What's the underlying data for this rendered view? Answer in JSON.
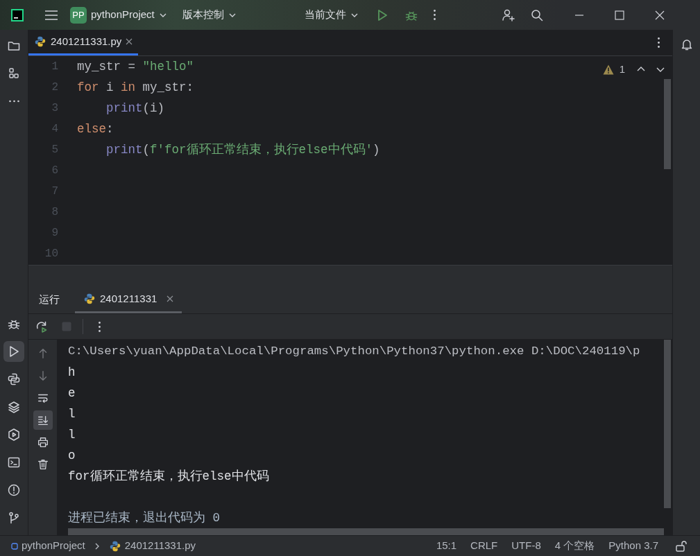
{
  "title_bar": {
    "project_badge": "PP",
    "project": "pythonProject",
    "vcs": "版本控制",
    "run_config": "当前文件"
  },
  "tool_windows_top": [
    {
      "kind": "folder",
      "selected": false
    },
    {
      "kind": "structure",
      "selected": false
    },
    {
      "kind": "more",
      "selected": false
    }
  ],
  "tool_windows_bottom": [
    {
      "kind": "bug",
      "selected": false
    },
    {
      "kind": "run",
      "selected": true
    },
    {
      "kind": "python",
      "selected": false
    },
    {
      "kind": "layers",
      "selected": false
    },
    {
      "kind": "services",
      "selected": false
    },
    {
      "kind": "terminal",
      "selected": false
    },
    {
      "kind": "problems",
      "selected": false
    },
    {
      "kind": "git",
      "selected": false
    }
  ],
  "editor_tabs": [
    {
      "label": "2401211331.py",
      "selected": true
    }
  ],
  "inspection": {
    "warnings": "1"
  },
  "code_lines": [
    {
      "number": "1",
      "tokens": [
        {
          "kind": "plain",
          "text": "my_str = "
        },
        {
          "kind": "string",
          "text": "\"hello\""
        }
      ]
    },
    {
      "number": "2",
      "tokens": [
        {
          "kind": "keyword",
          "text": "for"
        },
        {
          "kind": "plain",
          "text": " i "
        },
        {
          "kind": "keyword",
          "text": "in"
        },
        {
          "kind": "plain",
          "text": " my_str:"
        }
      ]
    },
    {
      "number": "3",
      "tokens": [
        {
          "kind": "builtin",
          "text": "    print"
        },
        {
          "kind": "plain",
          "text": "(i)"
        }
      ]
    },
    {
      "number": "4",
      "tokens": [
        {
          "kind": "keyword",
          "text": "else"
        },
        {
          "kind": "plain",
          "text": ":"
        }
      ]
    },
    {
      "number": "5",
      "tokens": [
        {
          "kind": "builtin",
          "text": "    print"
        },
        {
          "kind": "plain",
          "text": "("
        },
        {
          "kind": "string",
          "text": "f'for循环正常结束，执行else中代码'"
        },
        {
          "kind": "plain",
          "text": ")"
        }
      ]
    },
    {
      "number": "6"
    },
    {
      "number": "7"
    },
    {
      "number": "8"
    },
    {
      "number": "9"
    },
    {
      "number": "10"
    }
  ],
  "run_panel": {
    "title": "运行",
    "tabs": [
      {
        "label": "2401211331",
        "selected": true
      }
    ],
    "toolbar": [
      {
        "kind": "rerun",
        "disabled": false
      },
      {
        "kind": "stop",
        "disabled": true
      },
      {
        "kind": "kebab",
        "disabled": false
      }
    ],
    "side_tools": [
      {
        "kind": "up",
        "disabled": true,
        "selected": false
      },
      {
        "kind": "down",
        "disabled": true,
        "selected": false
      },
      {
        "kind": "wrap",
        "disabled": false,
        "selected": false
      },
      {
        "kind": "scroll-end",
        "disabled": false,
        "selected": true
      },
      {
        "kind": "print",
        "disabled": false,
        "selected": false
      },
      {
        "kind": "trash",
        "disabled": false,
        "selected": false
      }
    ],
    "console": [
      {
        "kind": "command",
        "text": "C:\\Users\\yuan\\AppData\\Local\\Programs\\Python\\Python37\\python.exe D:\\DOC\\240119\\p"
      },
      {
        "kind": "output",
        "text": "h"
      },
      {
        "kind": "output",
        "text": "e"
      },
      {
        "kind": "output",
        "text": "l"
      },
      {
        "kind": "output",
        "text": "l"
      },
      {
        "kind": "output",
        "text": "o"
      },
      {
        "kind": "output",
        "text": "for循环正常结束，执行else中代码"
      },
      {
        "kind": "exit",
        "text": "进程已结束，退出代码为 0"
      }
    ]
  },
  "status_bar": {
    "breadcrumbs": [
      "pythonProject",
      "2401211331.py"
    ],
    "items": [
      "15:1",
      "CRLF",
      "UTF-8",
      "4 个空格",
      "Python 3.7"
    ]
  }
}
